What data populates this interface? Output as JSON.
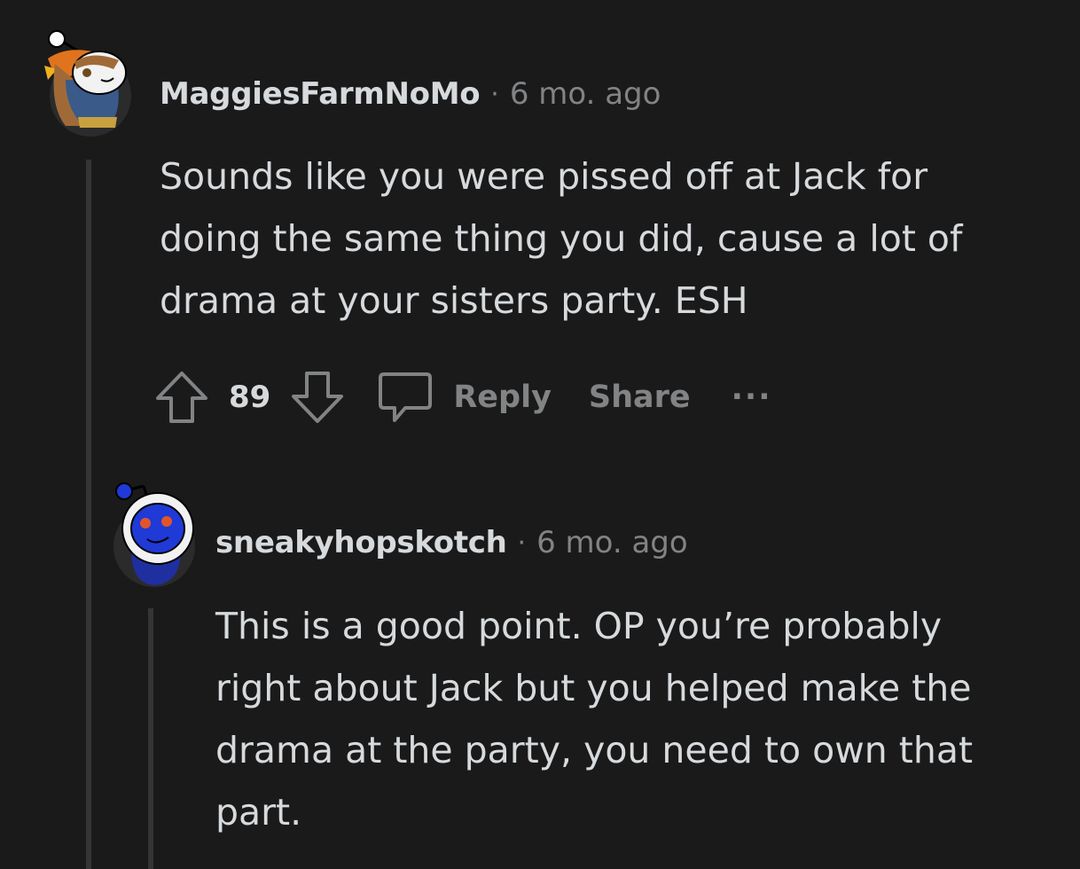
{
  "comments": [
    {
      "author": "MaggiesFarmNoMo",
      "separator": "·",
      "time": "6 mo. ago",
      "body": "Sounds like you were pissed off at Jack for doing the same thing you did, cause a lot of drama at your sisters party. ESH",
      "votes": "89",
      "reply_label": "Reply",
      "share_label": "Share",
      "more_label": "···"
    },
    {
      "author": "sneakyhopskotch",
      "separator": "·",
      "time": "6 mo. ago",
      "body": "This is a good point. OP you’re probably right about Jack but you helped make the drama at the party, you need to own that part."
    }
  ],
  "colors": {
    "background": "#1a1a1b",
    "text": "#d7dadc",
    "muted": "#818384",
    "thread_line": "#343536"
  },
  "icons": [
    "upvote-icon",
    "downvote-icon",
    "comment-bubble-icon",
    "more-options-icon",
    "reddit-avatar-icon"
  ]
}
